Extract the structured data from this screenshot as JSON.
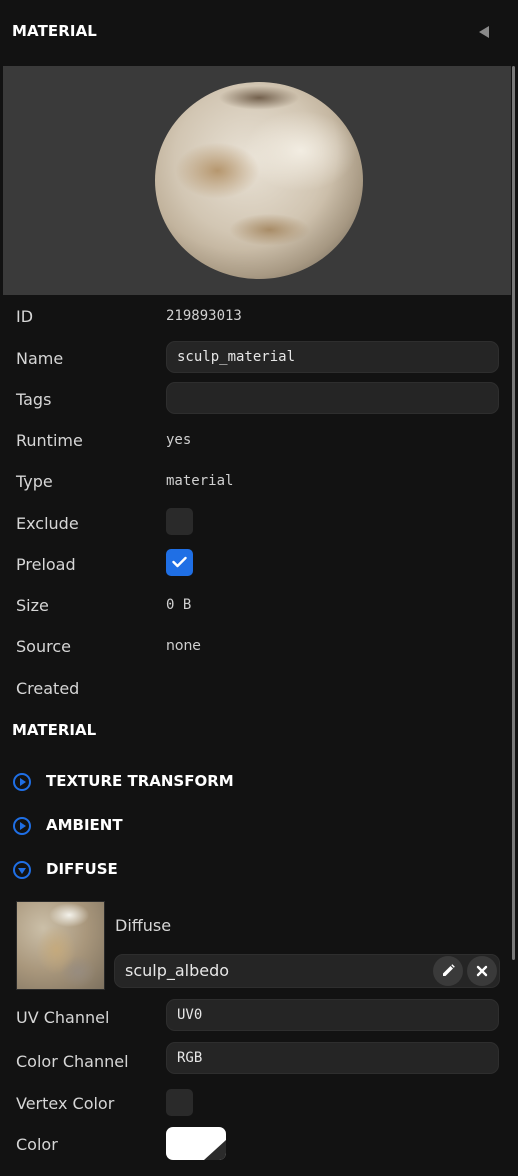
{
  "header": {
    "title": "MATERIAL"
  },
  "properties": {
    "id": {
      "label": "ID",
      "value": "219893013"
    },
    "name": {
      "label": "Name",
      "value": "sculp_material"
    },
    "tags": {
      "label": "Tags",
      "value": ""
    },
    "runtime": {
      "label": "Runtime",
      "value": "yes"
    },
    "type": {
      "label": "Type",
      "value": "material"
    },
    "exclude": {
      "label": "Exclude",
      "checked": false
    },
    "preload": {
      "label": "Preload",
      "checked": true
    },
    "size": {
      "label": "Size",
      "value": "0 B"
    },
    "source": {
      "label": "Source",
      "value": "none"
    },
    "created": {
      "label": "Created",
      "value": ""
    }
  },
  "material_section": {
    "title": "MATERIAL",
    "groups": [
      {
        "label": "TEXTURE TRANSFORM",
        "expanded": false
      },
      {
        "label": "AMBIENT",
        "expanded": false
      },
      {
        "label": "DIFFUSE",
        "expanded": true
      }
    ]
  },
  "diffuse": {
    "texture_label": "Diffuse",
    "texture_name": "sculp_albedo",
    "uv_channel": {
      "label": "UV Channel",
      "value": "UV0"
    },
    "color_channel": {
      "label": "Color Channel",
      "value": "RGB"
    },
    "vertex_color": {
      "label": "Vertex Color",
      "checked": false
    },
    "color": {
      "label": "Color",
      "value": "#ffffff"
    }
  },
  "colors": {
    "accent": "#1f6fe5",
    "background": "#121212"
  }
}
